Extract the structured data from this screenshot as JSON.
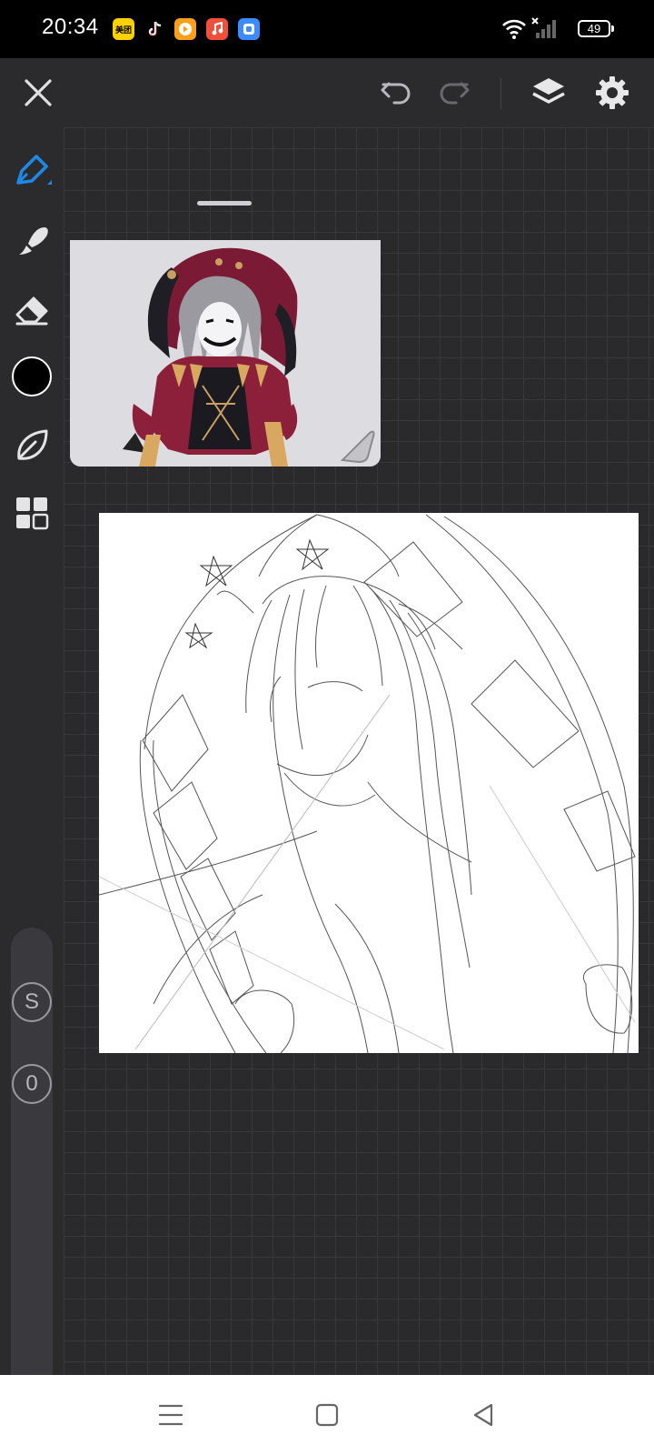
{
  "status_bar": {
    "time": "20:34",
    "battery": "49",
    "app_icons": [
      {
        "name": "meituan-app-icon",
        "label": "美团",
        "color": "#ffd100"
      },
      {
        "name": "tiktok-app-icon",
        "label": "",
        "color": "#000000"
      },
      {
        "name": "video-app-icon",
        "label": "",
        "color": "#ff9f1a"
      },
      {
        "name": "music-app-icon",
        "label": "",
        "color": "#f04f3c"
      },
      {
        "name": "blue-app-icon",
        "label": "",
        "color": "#3c8cff"
      }
    ]
  },
  "top_bar": {
    "icons": [
      "close-icon",
      "undo-icon",
      "redo-icon",
      "layers-icon",
      "settings-icon"
    ]
  },
  "tools": {
    "active": "pen",
    "accent_color": "#1e88e5",
    "current_color": "#000000",
    "size_label": "S",
    "opacity_label": "0"
  },
  "colors": {
    "ui_background": "#2a2a2d",
    "canvas": "#ffffff",
    "nav_bar": "#ffffff"
  }
}
